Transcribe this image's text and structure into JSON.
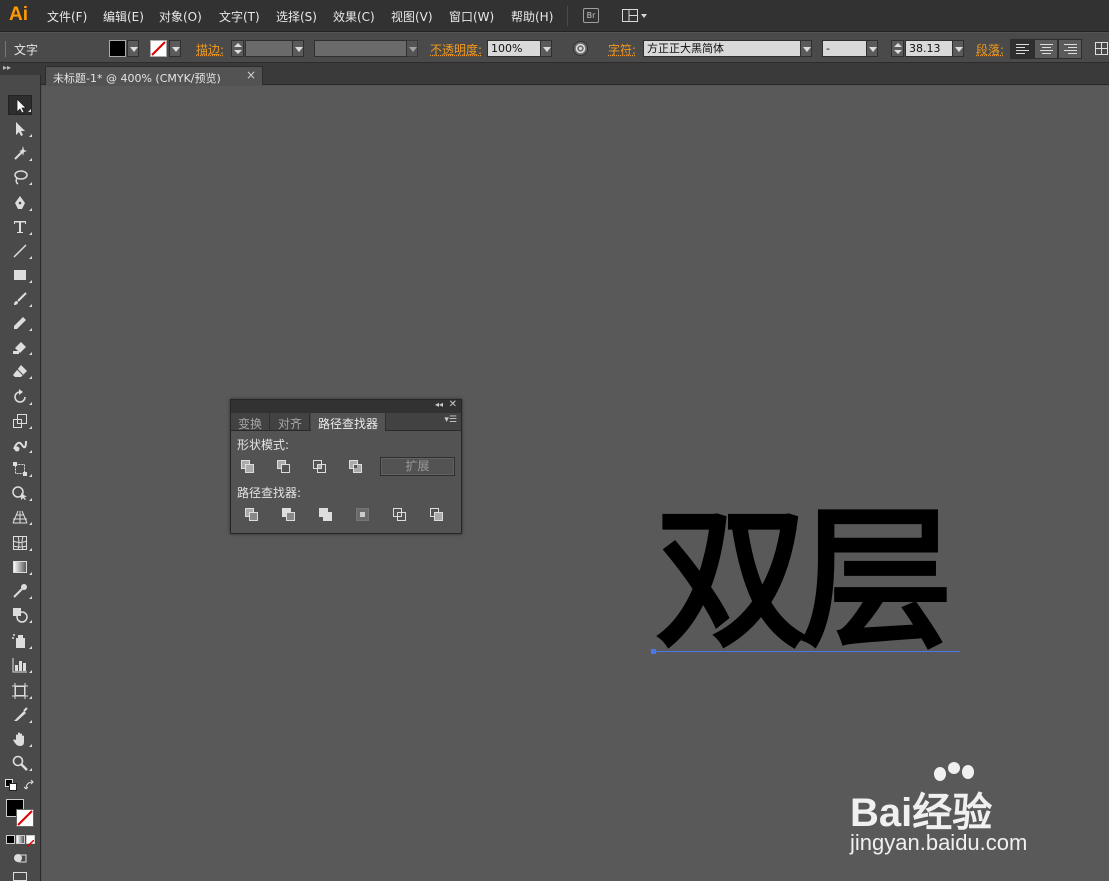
{
  "app": {
    "logo": "Ai"
  },
  "menu": [
    "文件(F)",
    "编辑(E)",
    "对象(O)",
    "文字(T)",
    "选择(S)",
    "效果(C)",
    "视图(V)",
    "窗口(W)",
    "帮助(H)"
  ],
  "menubar": {
    "bridge_label": "Br"
  },
  "control_bar": {
    "tool_label": "文字",
    "stroke_label": "描边:",
    "opacity_label": "不透明度:",
    "opacity_value": "100%",
    "character_label": "字符:",
    "font_family": "方正正大黑简体",
    "font_style": "-",
    "font_size": "38.13",
    "paragraph_label": "段落:"
  },
  "document": {
    "tab_title": "未标题-1* @ 400% (CMYK/预览)",
    "close_glyph": "×"
  },
  "pathfinder_panel": {
    "tabs": [
      "变换",
      "对齐",
      "路径查找器"
    ],
    "active_tab": "路径查找器",
    "shape_modes_label": "形状模式:",
    "pathfinders_label": "路径查找器:",
    "expand_label": "扩展"
  },
  "artwork": {
    "text": "双层"
  },
  "watermark": {
    "brand": "Bai经验",
    "url": "jingyan.baidu.com"
  },
  "colors": {
    "accent_orange": "#f39a1e",
    "logo_orange": "#ff9a00",
    "baseline_blue": "#4b78e6"
  }
}
